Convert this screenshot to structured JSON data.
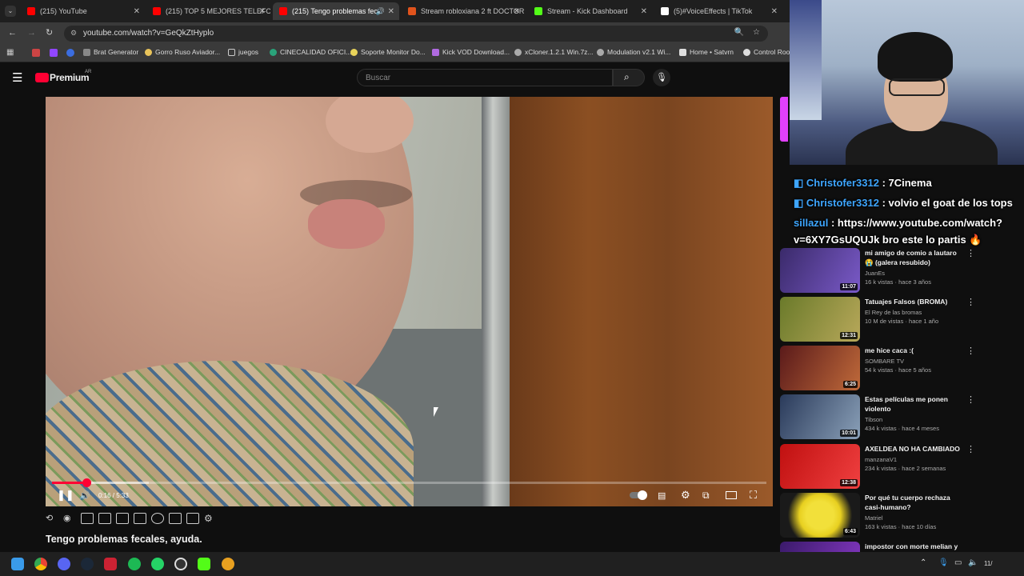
{
  "tabs": [
    {
      "title": "(215) YouTube",
      "color": "#ff0000"
    },
    {
      "title": "(215) TOP 5 MEJORES TELEFON",
      "color": "#ff0000"
    },
    {
      "title": "(215) Tengo problemas feca",
      "color": "#ff0000",
      "active": true
    },
    {
      "title": "Stream robloxiana 2 ft DOCTOR",
      "color": "#e0531c"
    },
    {
      "title": "Stream - Kick Dashboard",
      "color": "#53fc18"
    },
    {
      "title": "(5)#VoiceEffects | TikTok",
      "color": "#ffffff"
    }
  ],
  "address": {
    "url": "youtube.com/watch?v=GeQkZtHyplo"
  },
  "bookmarks": [
    "Brat Generator",
    "Gorro Ruso Aviador...",
    "juegos",
    "CINECALIDAD OFICI...",
    "Soporte Monitor Do...",
    "Kick VOD Download...",
    "xCloner.1.2.1 Win.7z...",
    "Modulation v2.1 Wi...",
    "Home • Satvrn",
    "Control Room"
  ],
  "youtube": {
    "logo": "Premium",
    "region": "AR",
    "search_placeholder": "Buscar"
  },
  "player": {
    "time": "0:16 / 5:33",
    "progress": 0.048,
    "buffered": 0.135,
    "state": "playing"
  },
  "video_title": "Tengo problemas fecales, ayuda.",
  "chat": [
    {
      "user": "Christofer3312",
      "text": " : 7Cinema"
    },
    {
      "user": "Christofer3312",
      "text": " : volvio el goat de los tops"
    },
    {
      "user": "sillazul",
      "text": " : https://www.youtube.com/watch?v=6XY7GsUQUJk bro este lo partis 🔥"
    }
  ],
  "recommendations": [
    {
      "title": "mi amigo de comio a lautaro 😭 (galera resubido)",
      "channel": "JuanEs",
      "meta": "16 k vistas · hace 3 años",
      "duration": "11:07",
      "thumb": "#5a3aa0"
    },
    {
      "title": "Tatuajes Falsos (BROMA)",
      "channel": "El Rey de las bromas",
      "meta": "10 M de vistas · hace 1 año",
      "duration": "12:31",
      "thumb": "#7a8a3a"
    },
    {
      "title": "me hice caca :(",
      "channel": "SOMBARE TV",
      "meta": "54 k vistas · hace 5 años",
      "duration": "6:25",
      "thumb": "#8a3a2a"
    },
    {
      "title": "Estas películas me ponen violento",
      "channel": "Tibson",
      "meta": "434 k vistas · hace 4 meses",
      "duration": "10:01",
      "thumb": "#3a5a7a"
    },
    {
      "title": "AXELDEA NO HA CAMBIADO",
      "channel": "manzanaV1",
      "meta": "234 k vistas · hace 2 semanas",
      "duration": "12:38",
      "thumb": "#b01818"
    },
    {
      "title": "Por qué tu cuerpo rechaza casi-humano?",
      "channel": "Matriel",
      "meta": "163 k vistas · hace 10 días",
      "duration": "6:43",
      "thumb": "#d6c21a"
    },
    {
      "title": "impostor con morte melian y",
      "channel": "",
      "meta": "",
      "duration": "",
      "thumb": "#5a2a8a"
    }
  ],
  "taskbar": {
    "clock": "11/"
  }
}
